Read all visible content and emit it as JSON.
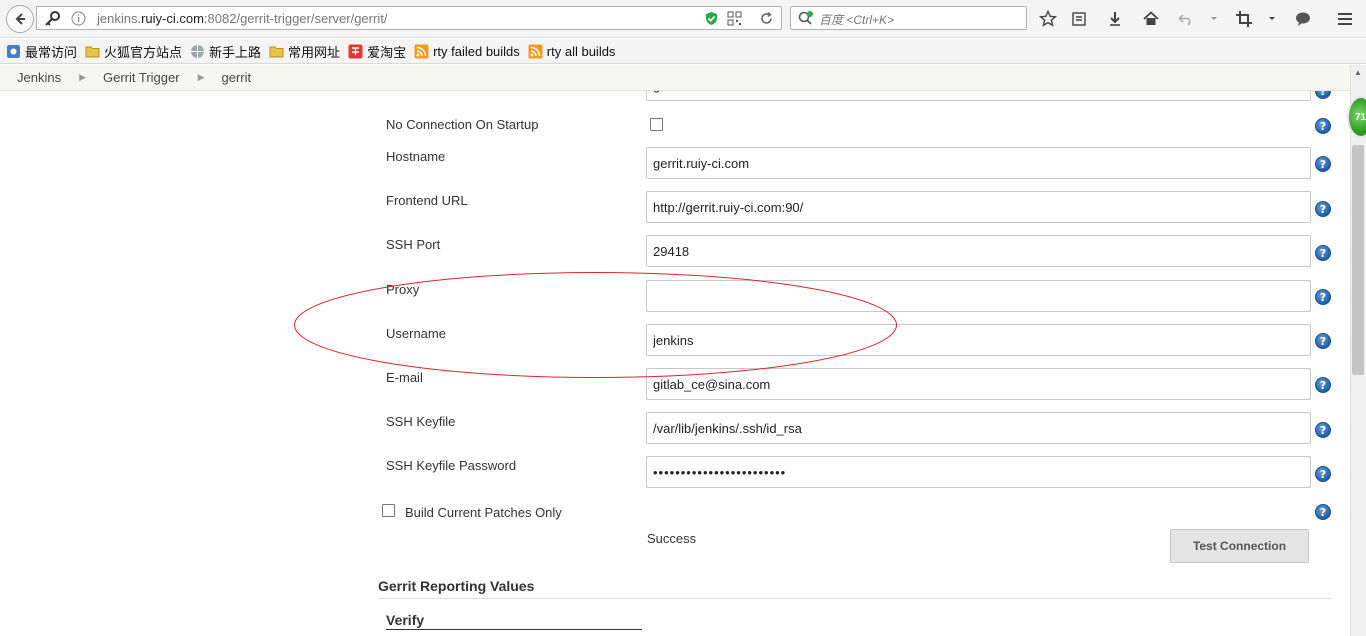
{
  "browser": {
    "url_prefix": "jenkins.",
    "url_host": "ruiy-ci.com",
    "url_rest": ":8082/gerrit-trigger/server/gerrit/",
    "search_placeholder": "百度 <Ctrl+K>"
  },
  "bookmarks": [
    {
      "label": "最常访问",
      "icon": "gear-icon"
    },
    {
      "label": "火狐官方站点",
      "icon": "folder-icon"
    },
    {
      "label": "新手上路",
      "icon": "globe-icon"
    },
    {
      "label": "常用网址",
      "icon": "folder-icon"
    },
    {
      "label": "爱淘宝",
      "icon": "taobao-icon"
    },
    {
      "label": "rty failed builds",
      "icon": "rss-icon"
    },
    {
      "label": "rty all builds",
      "icon": "rss-icon"
    }
  ],
  "breadcrumb": [
    "Jenkins",
    "Gerrit Trigger",
    "gerrit"
  ],
  "form": {
    "top_partial_value": "gerrit",
    "no_connection_label": "No Connection On Startup",
    "hostname_label": "Hostname",
    "hostname_value": "gerrit.ruiy-ci.com",
    "frontend_label": "Frontend URL",
    "frontend_value": "http://gerrit.ruiy-ci.com:90/",
    "ssh_port_label": "SSH Port",
    "ssh_port_value": "29418",
    "proxy_label": "Proxy",
    "proxy_value": "",
    "username_label": "Username",
    "username_value": "jenkins",
    "email_label": "E-mail",
    "email_value": "gitlab_ce@sina.com",
    "keyfile_label": "SSH Keyfile",
    "keyfile_value": "/var/lib/jenkins/.ssh/id_rsa",
    "keyfile_password_label": "SSH Keyfile Password",
    "keyfile_password_value": "••••••••••••••••••••••••",
    "build_current_label": "Build Current Patches Only",
    "status_text": "Success",
    "test_button": "Test Connection",
    "reporting_title": "Gerrit Reporting Values",
    "verify_title": "Verify"
  },
  "side_badge": "71",
  "colors": {
    "accent": "#1d5fae",
    "annotation": "#d9262a",
    "badge": "#2c9a23"
  }
}
